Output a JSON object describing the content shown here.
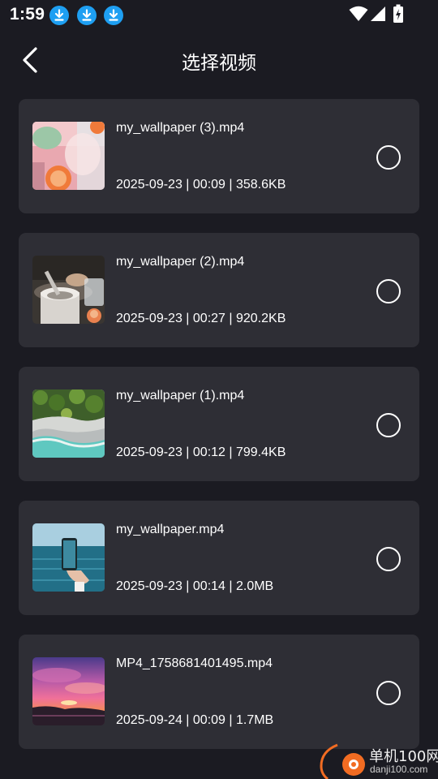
{
  "status_bar": {
    "time": "1:59",
    "notification_icons": [
      "download-icon",
      "download-icon",
      "download-icon"
    ],
    "system_icons": [
      "wifi-icon",
      "signal-icon",
      "battery-charging-icon"
    ]
  },
  "header": {
    "back_icon": "chevron-left-icon",
    "title": "选择视频"
  },
  "videos": [
    {
      "name": "my_wallpaper (3).mp4",
      "meta": "2025-09-23 | 00:09 | 358.6KB",
      "selected": false,
      "thumb": "drink-glass-thumbnail"
    },
    {
      "name": "my_wallpaper (2).mp4",
      "meta": "2025-09-23 | 00:27 | 920.2KB",
      "selected": false,
      "thumb": "mortar-kitchen-thumbnail"
    },
    {
      "name": "my_wallpaper (1).mp4",
      "meta": "2025-09-23 | 00:12 | 799.4KB",
      "selected": false,
      "thumb": "aerial-coast-thumbnail"
    },
    {
      "name": "my_wallpaper.mp4",
      "meta": "2025-09-23 | 00:14 | 2.0MB",
      "selected": false,
      "thumb": "phone-ocean-thumbnail"
    },
    {
      "name": "MP4_1758681401495.mp4",
      "meta": "2025-09-24 | 00:09 | 1.7MB",
      "selected": false,
      "thumb": "sunset-sky-thumbnail"
    }
  ],
  "watermark": {
    "text": "单机100网",
    "url": "danji100.com"
  },
  "colors": {
    "background": "#1b1b22",
    "card": "#2e2e35",
    "download_badge": "#1e9ff2",
    "text": "#ffffff",
    "watermark_accent": "#f26c22"
  }
}
